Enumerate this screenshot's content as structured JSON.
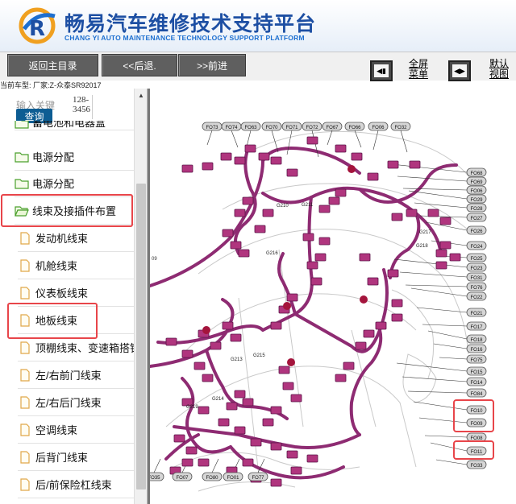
{
  "header": {
    "title": "畅易汽车维修技术支持平台",
    "subtitle": "CHANG YI AUTO MAINTENANCE TECHNOLOGY SUPPORT PLATFORM"
  },
  "toolbar": {
    "home_label": "返回主目录",
    "back_label": "<<后退.",
    "forward_label": ">>前进",
    "fullscreen_label_1": "全屏",
    "fullscreen_label_2": "菜单",
    "default_label_1": "默认",
    "default_label_2": "视图",
    "vehicle_line": "当前车型:  厂家:Z-众泰SR92017"
  },
  "sidebar": {
    "search_label": "输入关键",
    "search_value": "128-3456",
    "query_label": "查询",
    "items": [
      {
        "label": "蓄电池和电器盒",
        "kind": "folder"
      },
      {
        "label": "电源分配",
        "kind": "folder"
      },
      {
        "label": "电源分配",
        "kind": "folder"
      },
      {
        "label": "线束及接插件布置",
        "kind": "folder-open"
      },
      {
        "label": "发动机线束",
        "kind": "file"
      },
      {
        "label": "机舱线束",
        "kind": "file"
      },
      {
        "label": "仪表板线束",
        "kind": "file"
      },
      {
        "label": "地板线束",
        "kind": "file"
      },
      {
        "label": "顶棚线束、变速箱搭铁线",
        "kind": "file"
      },
      {
        "label": "左/右前门线束",
        "kind": "file"
      },
      {
        "label": "左/右后门线束",
        "kind": "file"
      },
      {
        "label": "空调线束",
        "kind": "file"
      },
      {
        "label": "后背门线束",
        "kind": "file"
      },
      {
        "label": "后/前保险杠线束",
        "kind": "file"
      }
    ]
  },
  "diagram": {
    "top_labels": [
      "FO73",
      "FO74",
      "FO63",
      "FO70",
      "FO71",
      "FO72",
      "FO67",
      "FO66",
      "FO06",
      "FO32"
    ],
    "right_labels": [
      "FO68",
      "FO69",
      "FO06",
      "FO29",
      "FO28",
      "FO27",
      "FO26",
      "FO24",
      "FO25",
      "FO23",
      "FO31",
      "FO76",
      "FO22",
      "FO21",
      "FO17",
      "FO18",
      "FO16",
      "FO75",
      "FO15",
      "FO14",
      "FO84",
      "FO10",
      "FO09",
      "FO08",
      "FO11",
      "FO33"
    ],
    "bottom_labels": [
      "FO35",
      "FO07",
      "FO80",
      "FO01",
      "FO77"
    ],
    "ground_labels": [
      "G210",
      "G211",
      "G217",
      "G218",
      "G216",
      "G215",
      "G213",
      "G214",
      "G219"
    ],
    "left_partial_label": "09",
    "colors": {
      "harness": "#8e2b72",
      "connector": "#b0357e",
      "label_fill": "#d6d6d6",
      "highlight": "#e8454a"
    }
  }
}
